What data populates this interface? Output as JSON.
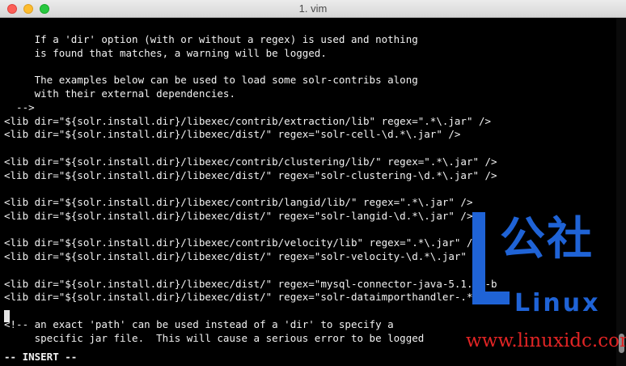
{
  "window": {
    "title": "1. vim",
    "buttons": {
      "close": "close",
      "minimize": "minimize",
      "maximize": "maximize"
    }
  },
  "editor": {
    "lines": [
      "     If a 'dir' option (with or without a regex) is used and nothing",
      "     is found that matches, a warning will be logged.",
      "",
      "     The examples below can be used to load some solr-contribs along",
      "     with their external dependencies.",
      "  -->",
      "<lib dir=\"${solr.install.dir}/libexec/contrib/extraction/lib\" regex=\".*\\.jar\" />",
      "<lib dir=\"${solr.install.dir}/libexec/dist/\" regex=\"solr-cell-\\d.*\\.jar\" />",
      "",
      "<lib dir=\"${solr.install.dir}/libexec/contrib/clustering/lib/\" regex=\".*\\.jar\" />",
      "<lib dir=\"${solr.install.dir}/libexec/dist/\" regex=\"solr-clustering-\\d.*\\.jar\" />",
      "",
      "<lib dir=\"${solr.install.dir}/libexec/contrib/langid/lib/\" regex=\".*\\.jar\" />",
      "<lib dir=\"${solr.install.dir}/libexec/dist/\" regex=\"solr-langid-\\d.*\\.jar\" />",
      "",
      "<lib dir=\"${solr.install.dir}/libexec/contrib/velocity/lib\" regex=\".*\\.jar\" />",
      "<lib dir=\"${solr.install.dir}/libexec/dist/\" regex=\"solr-velocity-\\d.*\\.jar\" />",
      "",
      "<lib dir=\"${solr.install.dir}/libexec/dist/\" regex=\"mysql-connector-java-5.1.40-b",
      "<lib dir=\"${solr.install.dir}/libexec/dist/\" regex=\"solr-dataimporthandler-.*\\.ja",
      "",
      "<!-- an exact 'path' can be used instead of a 'dir' to specify a",
      "     specific jar file.  This will cause a serious error to be logged"
    ],
    "mode": "-- INSERT --"
  },
  "watermark": {
    "brand_cn": "公社",
    "brand_en": "Linux",
    "site": "www.linuxidc.com",
    "colors": {
      "blue": "#1f63d6",
      "red": "#e02424"
    }
  },
  "scrollbar": {
    "position_fraction": 0.97
  }
}
